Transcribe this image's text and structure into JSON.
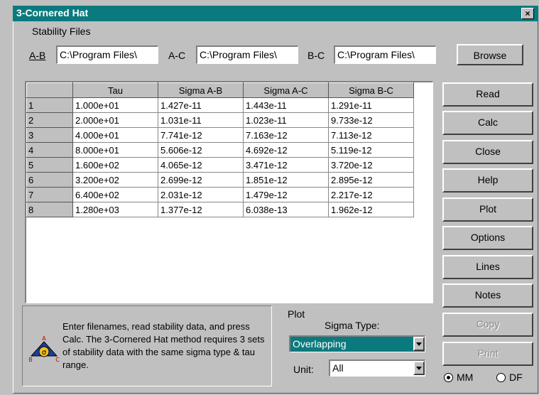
{
  "window": {
    "title": "3-Cornered Hat",
    "close_glyph": "×"
  },
  "stability": {
    "group_label": "Stability Files",
    "ab_label": "A-B",
    "ac_label": "A-C",
    "bc_label": "B-C",
    "ab_value": "C:\\Program Files\\",
    "ac_value": "C:\\Program Files\\",
    "bc_value": "C:\\Program Files\\",
    "browse_label": "Browse"
  },
  "table": {
    "columns": [
      "Tau",
      "Sigma A-B",
      "Sigma A-C",
      "Sigma B-C"
    ],
    "rows": [
      {
        "n": "1",
        "tau": "1.000e+01",
        "ab": "1.427e-11",
        "ac": "1.443e-11",
        "bc": "1.291e-11"
      },
      {
        "n": "2",
        "tau": "2.000e+01",
        "ab": "1.031e-11",
        "ac": "1.023e-11",
        "bc": "9.733e-12"
      },
      {
        "n": "3",
        "tau": "4.000e+01",
        "ab": "7.741e-12",
        "ac": "7.163e-12",
        "bc": "7.113e-12"
      },
      {
        "n": "4",
        "tau": "8.000e+01",
        "ab": "5.606e-12",
        "ac": "4.692e-12",
        "bc": "5.119e-12"
      },
      {
        "n": "5",
        "tau": "1.600e+02",
        "ab": "4.065e-12",
        "ac": "3.471e-12",
        "bc": "3.720e-12"
      },
      {
        "n": "6",
        "tau": "3.200e+02",
        "ab": "2.699e-12",
        "ac": "1.851e-12",
        "bc": "2.895e-12"
      },
      {
        "n": "7",
        "tau": "6.400e+02",
        "ab": "2.031e-12",
        "ac": "1.479e-12",
        "bc": "2.217e-12"
      },
      {
        "n": "8",
        "tau": "1.280e+03",
        "ab": "1.377e-12",
        "ac": "6.038e-13",
        "bc": "1.962e-12"
      }
    ]
  },
  "buttons": {
    "read": "Read",
    "calc": "Calc",
    "close": "Close",
    "help": "Help",
    "plot": "Plot",
    "options": "Options",
    "lines": "Lines",
    "notes": "Notes",
    "copy": "Copy",
    "print": "Print"
  },
  "info": {
    "message": "Enter filenames, read stability data, and press Calc.  The 3-Cornered Hat method requires 3 sets of stability data with the same sigma type & tau range.",
    "icon_letters": {
      "top": "A",
      "center": "σ",
      "left": "B",
      "right": "C"
    }
  },
  "plot": {
    "group_label": "Plot",
    "sigma_type_label": "Sigma Type:",
    "sigma_type_value": "Overlapping",
    "unit_label": "Unit:",
    "unit_value": "All"
  },
  "radios": {
    "mm_label": "MM",
    "df_label": "DF",
    "mm_selected": true,
    "df_selected": false
  },
  "colors": {
    "title_bar": "#0b7a7e",
    "face": "#c0c0c0",
    "selection": "#0b7a7e"
  }
}
